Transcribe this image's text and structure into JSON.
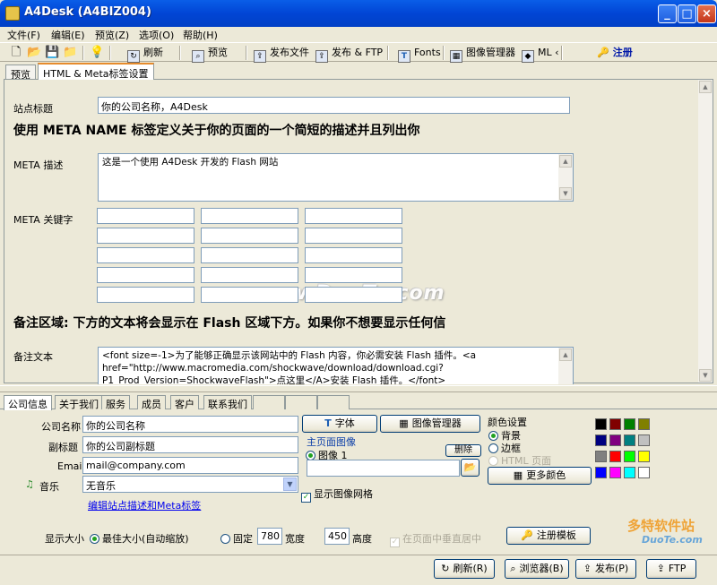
{
  "window": {
    "title": "A4Desk (A4BIZ004)"
  },
  "menu": [
    "文件(F)",
    "编辑(E)",
    "预览(Z)",
    "选项(O)",
    "帮助(H)"
  ],
  "toolbar": {
    "refresh": "刷新",
    "preview": "预览",
    "publish_file": "发布文件",
    "publish_ftp": "发布 & FTP",
    "fonts": "Fonts",
    "image_manager": "图像管理器",
    "html": "ML ‹",
    "register": "注册"
  },
  "top_tabs": [
    "预览",
    "HTML & Meta标签设置"
  ],
  "html_meta": {
    "site_title_label": "站点标题",
    "site_title_value": "你的公司名称，A4Desk",
    "meta_heading": "使用 META NAME 标签定义关于你的页面的一个简短的描述并且列出你",
    "meta_desc_label": "META 描述",
    "meta_desc_value": "这是一个使用 A4Desk 开发的 Flash 网站",
    "meta_kw_label": "META 关键字",
    "remark_heading": "备注区域: 下方的文本将会显示在 Flash 区域下方。如果你不想要显示任何信",
    "remark_label": "备注文本",
    "remark_value": "<font size=-1>为了能够正确显示该网站中的 Flash 内容，你必需安装 Flash 插件。<a href=\"http://www.macromedia.com/shockwave/download/download.cgi?P1_Prod_Version=ShockwaveFlash\">点这里</A>安装 Flash 插件。</font>",
    "watermark": "www.DuoTe.com"
  },
  "bottom_tabs": [
    "公司信息",
    "关于我们",
    "服务",
    "成员",
    "客户",
    "联系我们",
    "",
    "",
    ""
  ],
  "company": {
    "name_label": "公司名称",
    "name_value": "你的公司名称",
    "subtitle_label": "副标题",
    "subtitle_value": "你的公司副标题",
    "email_label": "Email",
    "email_value": "mail@company.com",
    "music_label": "音乐",
    "music_value": "无音乐",
    "edit_link": "编辑站点描述和Meta标签"
  },
  "middle": {
    "font_button": "字体",
    "image_mgr_button": "图像管理器",
    "home_image_label": "主页面图像",
    "image1_label": "图像 1",
    "delete_button": "删除",
    "show_grid_label": "显示图像网格"
  },
  "colors": {
    "heading": "颜色设置",
    "background": "背景",
    "border": "边框",
    "html_page": "HTML 页面",
    "more_colors": "更多颜色",
    "swatches": [
      "#000000",
      "#800000",
      "#008000",
      "#808000",
      "#000080",
      "#800080",
      "#008080",
      "#c0c0c0",
      "#808080",
      "#ff0000",
      "#00ff00",
      "#ffff00",
      "#0000ff",
      "#ff00ff",
      "#00ffff",
      "#ffffff"
    ]
  },
  "display": {
    "size_label": "显示大小",
    "best_size": "最佳大小(自动缩放)",
    "fixed": "固定",
    "width_value": "780",
    "width_label": "宽度",
    "height_value": "450",
    "height_label": "高度",
    "center_label": "在页面中垂直居中",
    "register_template": "注册模板"
  },
  "status": {
    "refresh": "刷新(R)",
    "browser": "浏览器(B)",
    "publish": "发布(P)",
    "ftp": "FTP"
  },
  "brand": {
    "text": "多特软件站",
    "url": "DuoTe.com"
  }
}
